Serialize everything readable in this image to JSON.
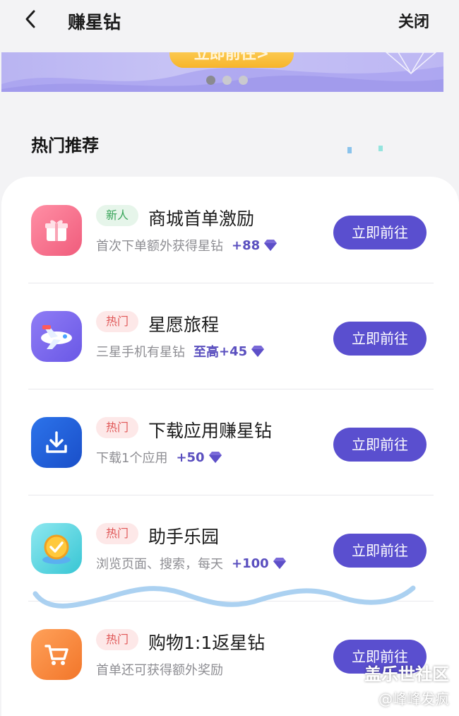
{
  "header": {
    "title": "赚星钻",
    "close_label": "关闭"
  },
  "banner": {
    "button_label": "立即前往>",
    "dots_count": 3,
    "active_dot": 0
  },
  "section": {
    "title": "热门推荐"
  },
  "items": [
    {
      "badge": "新人",
      "badge_type": "new",
      "title": "商城首单激励",
      "desc": "首次下单额外获得星钻",
      "reward_prefix": "",
      "reward": "+88",
      "button": "立即前往",
      "icon": "gift-icon",
      "icon_color": "#f46d8a"
    },
    {
      "badge": "热门",
      "badge_type": "hot",
      "title": "星愿旅程",
      "desc": "三星手机有星钻",
      "reward_prefix": "至高",
      "reward": "+45",
      "button": "立即前往",
      "icon": "airplane-icon",
      "icon_color": "#7a6cf0"
    },
    {
      "badge": "热门",
      "badge_type": "hot",
      "title": "下载应用赚星钻",
      "desc": "下载1个应用",
      "reward_prefix": "",
      "reward": "+50",
      "button": "立即前往",
      "icon": "download-icon",
      "icon_color": "#1f5fd8"
    },
    {
      "badge": "热门",
      "badge_type": "hot",
      "title": "助手乐园",
      "desc": "浏览页面、搜索，每天",
      "reward_prefix": "",
      "reward": "+100",
      "button": "立即前往",
      "icon": "checkmark-coin-icon",
      "icon_color": "#38c6d4"
    },
    {
      "badge": "热门",
      "badge_type": "hot",
      "title": "购物1:1返星钻",
      "desc": "首单还可获得额外奖励",
      "reward_prefix": "",
      "reward": "",
      "button": "立即前往",
      "icon": "cart-icon",
      "icon_color": "#f5833a"
    }
  ],
  "watermark": {
    "line1": "盖乐世社区",
    "line2": "@峰峰发疯"
  },
  "colors": {
    "accent": "#5a4fcf",
    "background": "#f3f3f5"
  }
}
